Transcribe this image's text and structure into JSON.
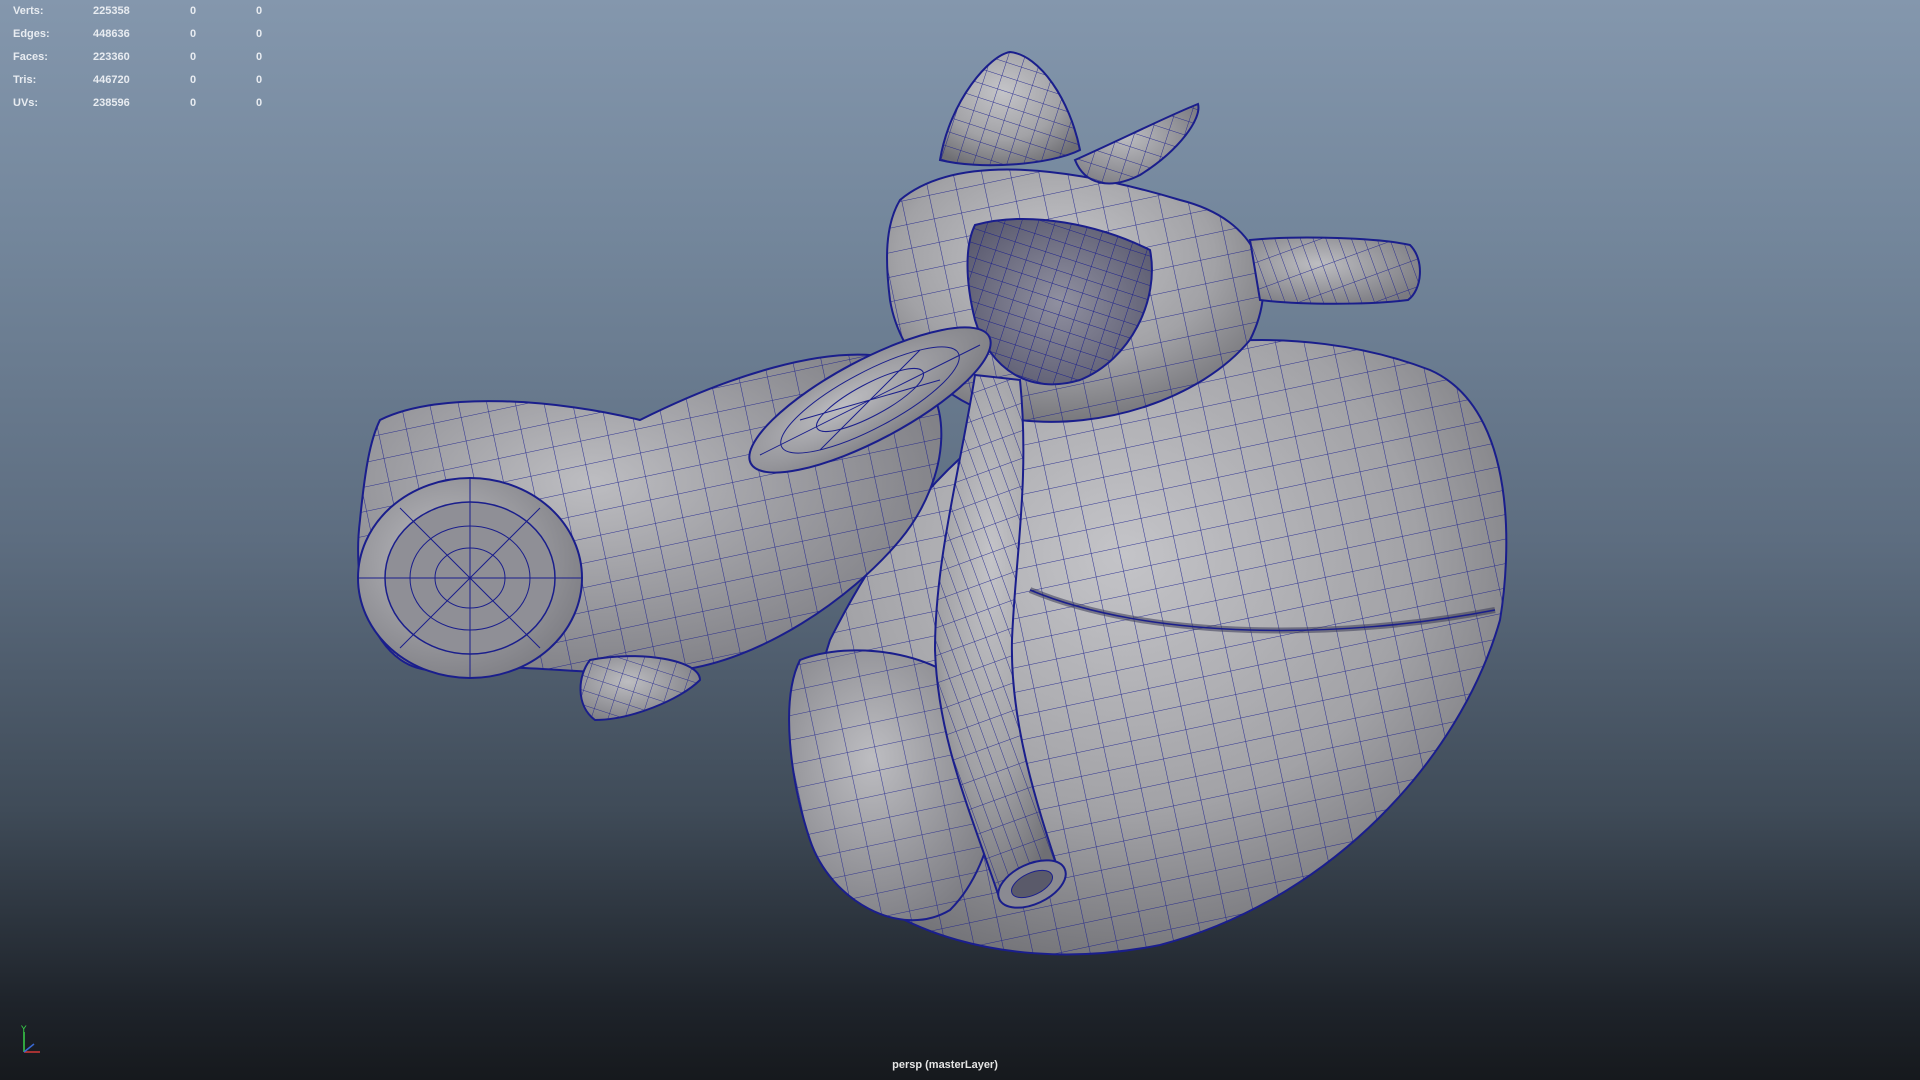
{
  "hud": {
    "rows": [
      {
        "label": "Verts:",
        "total": "225358",
        "selected": "0",
        "component": "0"
      },
      {
        "label": "Edges:",
        "total": "448636",
        "selected": "0",
        "component": "0"
      },
      {
        "label": "Faces:",
        "total": "223360",
        "selected": "0",
        "component": "0"
      },
      {
        "label": "Tris:",
        "total": "446720",
        "selected": "0",
        "component": "0"
      },
      {
        "label": "UVs:",
        "total": "238596",
        "selected": "0",
        "component": "0"
      }
    ]
  },
  "viewport": {
    "camera_label": "persp (masterLayer)",
    "model": "heart-wireframe-model",
    "wire_color": "#1a1e8c",
    "surface_color": "#a4a4a8",
    "background_top": "#8497ad",
    "background_bottom": "#16191d"
  },
  "axis_indicator": {
    "y_label": "Y",
    "y_color": "#39d24a",
    "x_color": "#d23939",
    "z_color": "#3968d2"
  }
}
